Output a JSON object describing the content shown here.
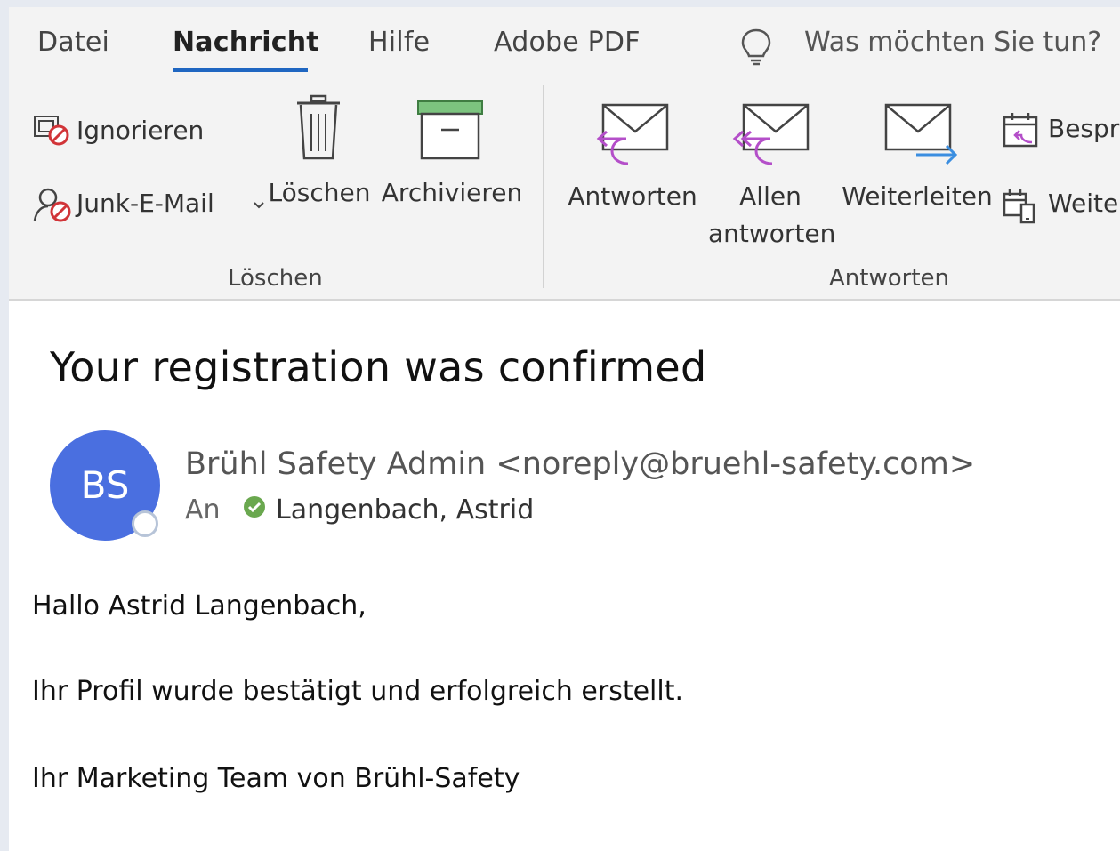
{
  "tabs": {
    "file": "Datei",
    "message": "Nachricht",
    "help": "Hilfe",
    "adobe": "Adobe PDF"
  },
  "tell_me": {
    "placeholder": "Was möchten Sie tun?",
    "icon": "lightbulb-icon"
  },
  "ribbon": {
    "delete_group": {
      "label": "Löschen",
      "ignore": "Ignorieren",
      "junk": "Junk-E-Mail",
      "delete": "Löschen",
      "archive": "Archivieren"
    },
    "respond_group": {
      "label": "Antworten",
      "reply": "Antworten",
      "reply_all_line1": "Allen",
      "reply_all_line2": "antworten",
      "forward": "Weiterleiten",
      "meeting": "Bespre",
      "more": "Weiter"
    }
  },
  "message": {
    "subject": "Your registration was confirmed",
    "avatar_initials": "BS",
    "avatar_color": "#4a6fe0",
    "sender": "Brühl Safety Admin <noreply@bruehl-safety.com>",
    "to_label": "An",
    "recipient": "Langenbach, Astrid",
    "body": {
      "line1": "Hallo Astrid Langenbach,",
      "line2": "Ihr Profil wurde bestätigt und erfolgreich erstellt.",
      "line3": "Ihr Marketing Team von Brühl-Safety"
    }
  },
  "colors": {
    "accent": "#1f66c1",
    "reply_purple": "#b44fc9",
    "forward_blue": "#3b8ee0",
    "archive_green": "#7cc47f"
  }
}
